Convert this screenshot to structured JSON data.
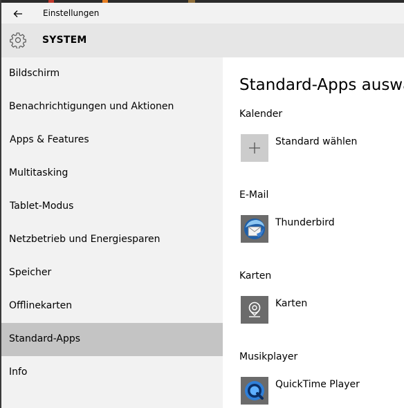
{
  "window": {
    "title": "Einstellungen"
  },
  "header": {
    "section_title": "SYSTEM"
  },
  "sidebar": {
    "items": [
      {
        "label": "Bildschirm"
      },
      {
        "label": "Benachrichtigungen und Aktionen"
      },
      {
        "label": "Apps & Features"
      },
      {
        "label": "Multitasking"
      },
      {
        "label": "Tablet-Modus"
      },
      {
        "label": "Netzbetrieb und Energiesparen"
      },
      {
        "label": "Speicher"
      },
      {
        "label": "Offlinekarten"
      },
      {
        "label": "Standard-Apps",
        "selected": true
      },
      {
        "label": "Info"
      }
    ]
  },
  "main": {
    "title": "Standard-Apps auswäh",
    "categories": [
      {
        "label": "Kalender",
        "app": "Standard wählen",
        "icon": "plus-icon"
      },
      {
        "label": "E-Mail",
        "app": "Thunderbird",
        "icon": "thunderbird-icon"
      },
      {
        "label": "Karten",
        "app": "Karten",
        "icon": "maps-icon"
      },
      {
        "label": "Musikplayer",
        "app": "QuickTime Player",
        "icon": "quicktime-icon"
      }
    ]
  },
  "colors": {
    "sidebar_bg": "#f2f2f2",
    "header_bg": "#e6e6e6",
    "selected_item_bg": "#c4c4c4",
    "app_tile_bg": "#6b6b6b",
    "add_tile_bg": "#cccccc"
  }
}
